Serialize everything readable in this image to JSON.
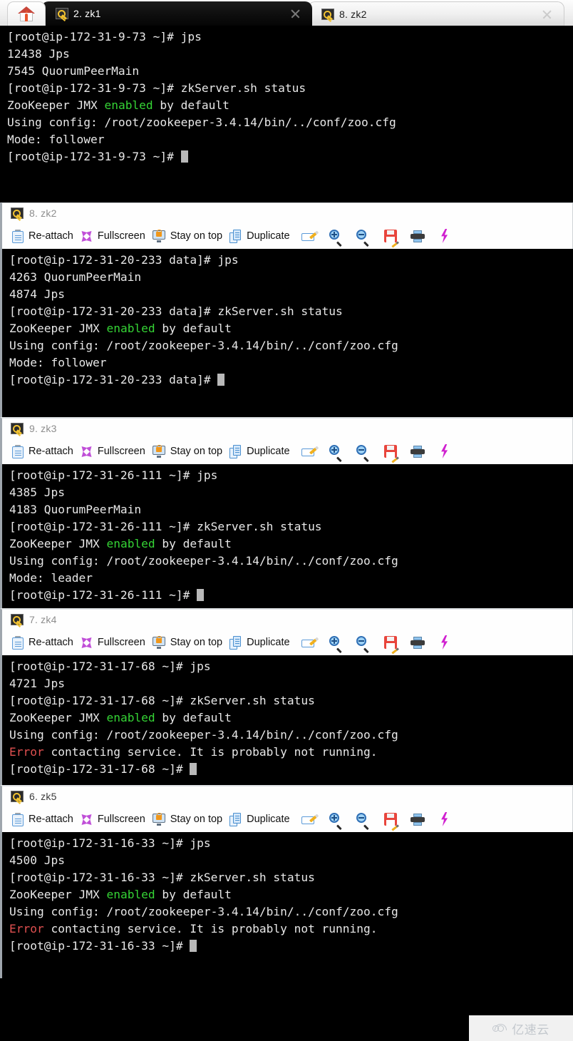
{
  "window": {
    "home_tab_icon": "house-icon",
    "tabs": [
      {
        "label": "2. zk1",
        "icon": "key-icon",
        "active": true,
        "close": "close-icon"
      },
      {
        "label": "8. zk2",
        "icon": "key-icon",
        "active": false,
        "close": "close-icon"
      }
    ]
  },
  "toolbar": {
    "reattach": "Re-attach",
    "fullscreen": "Fullscreen",
    "stay_on_top": "Stay on top",
    "duplicate": "Duplicate",
    "icons": [
      "rename-icon",
      "zoom-in-icon",
      "zoom-out-icon",
      "save-icon",
      "print-icon",
      "lightning-icon"
    ]
  },
  "panels": [
    {
      "id": "zk1",
      "has_header": false,
      "title": "2. zk1",
      "lines": [
        [
          {
            "t": "[root@ip-172-31-9-73 ~]# jps"
          }
        ],
        [
          {
            "t": "12438 Jps"
          }
        ],
        [
          {
            "t": "7545 QuorumPeerMain"
          }
        ],
        [
          {
            "t": "[root@ip-172-31-9-73 ~]# zkServer.sh status"
          }
        ],
        [
          {
            "t": "ZooKeeper JMX "
          },
          {
            "t": "enabled",
            "c": "g"
          },
          {
            "t": " by default"
          }
        ],
        [
          {
            "t": "Using config: /root/zookeeper-3.4.14/bin/../conf/zoo.cfg"
          }
        ],
        [
          {
            "t": "Mode: follower"
          }
        ],
        [
          {
            "t": "[root@ip-172-31-9-73 ~]# ",
            "cursor": true
          }
        ]
      ]
    },
    {
      "id": "zk2",
      "has_header": true,
      "title": "8. zk2",
      "title_strong": false,
      "lines": [
        [
          {
            "t": "[root@ip-172-31-20-233 data]# jps"
          }
        ],
        [
          {
            "t": "4263 QuorumPeerMain"
          }
        ],
        [
          {
            "t": "4874 Jps"
          }
        ],
        [
          {
            "t": "[root@ip-172-31-20-233 data]# zkServer.sh status"
          }
        ],
        [
          {
            "t": "ZooKeeper JMX "
          },
          {
            "t": "enabled",
            "c": "g"
          },
          {
            "t": " by default"
          }
        ],
        [
          {
            "t": "Using config: /root/zookeeper-3.4.14/bin/../conf/zoo.cfg"
          }
        ],
        [
          {
            "t": "Mode: follower"
          }
        ],
        [
          {
            "t": "[root@ip-172-31-20-233 data]# ",
            "cursor": true
          }
        ]
      ]
    },
    {
      "id": "zk3",
      "has_header": true,
      "title": "9. zk3",
      "title_strong": false,
      "lines": [
        [
          {
            "t": "[root@ip-172-31-26-111 ~]# jps"
          }
        ],
        [
          {
            "t": "4385 Jps"
          }
        ],
        [
          {
            "t": "4183 QuorumPeerMain"
          }
        ],
        [
          {
            "t": "[root@ip-172-31-26-111 ~]# zkServer.sh status"
          }
        ],
        [
          {
            "t": "ZooKeeper JMX "
          },
          {
            "t": "enabled",
            "c": "g"
          },
          {
            "t": " by default"
          }
        ],
        [
          {
            "t": "Using config: /root/zookeeper-3.4.14/bin/../conf/zoo.cfg"
          }
        ],
        [
          {
            "t": "Mode: leader"
          }
        ],
        [
          {
            "t": "[root@ip-172-31-26-111 ~]# ",
            "cursor": true
          }
        ]
      ]
    },
    {
      "id": "zk4",
      "has_header": true,
      "title": "7. zk4",
      "title_strong": false,
      "lines": [
        [
          {
            "t": "[root@ip-172-31-17-68 ~]# jps"
          }
        ],
        [
          {
            "t": "4721 Jps"
          }
        ],
        [
          {
            "t": "[root@ip-172-31-17-68 ~]# zkServer.sh status"
          }
        ],
        [
          {
            "t": "ZooKeeper JMX "
          },
          {
            "t": "enabled",
            "c": "g"
          },
          {
            "t": " by default"
          }
        ],
        [
          {
            "t": "Using config: /root/zookeeper-3.4.14/bin/../conf/zoo.cfg"
          }
        ],
        [
          {
            "t": "Error",
            "c": "r"
          },
          {
            "t": " contacting service. It is probably not running."
          }
        ],
        [
          {
            "t": "[root@ip-172-31-17-68 ~]# ",
            "cursor": true
          }
        ]
      ]
    },
    {
      "id": "zk5",
      "has_header": true,
      "title": "6. zk5",
      "title_strong": true,
      "lines": [
        [
          {
            "t": "[root@ip-172-31-16-33 ~]# jps"
          }
        ],
        [
          {
            "t": "4500 Jps"
          }
        ],
        [
          {
            "t": "[root@ip-172-31-16-33 ~]# zkServer.sh status"
          }
        ],
        [
          {
            "t": "ZooKeeper JMX "
          },
          {
            "t": "enabled",
            "c": "g"
          },
          {
            "t": " by default"
          }
        ],
        [
          {
            "t": "Using config: /root/zookeeper-3.4.14/bin/../conf/zoo.cfg"
          }
        ],
        [
          {
            "t": "Error",
            "c": "r"
          },
          {
            "t": " contacting service. It is probably not running."
          }
        ],
        [
          {
            "t": "[root@ip-172-31-16-33 ~]# ",
            "cursor": true
          }
        ]
      ]
    }
  ],
  "watermark": {
    "text": "亿速云",
    "icon": "cloud-icon"
  },
  "colors": {
    "terminal_bg": "#000000",
    "terminal_fg": "#e8e8e8",
    "green": "#35d435",
    "red": "#e05050",
    "tab_active_bg": "#0e0e0e",
    "chrome_bg": "#fefefe"
  }
}
